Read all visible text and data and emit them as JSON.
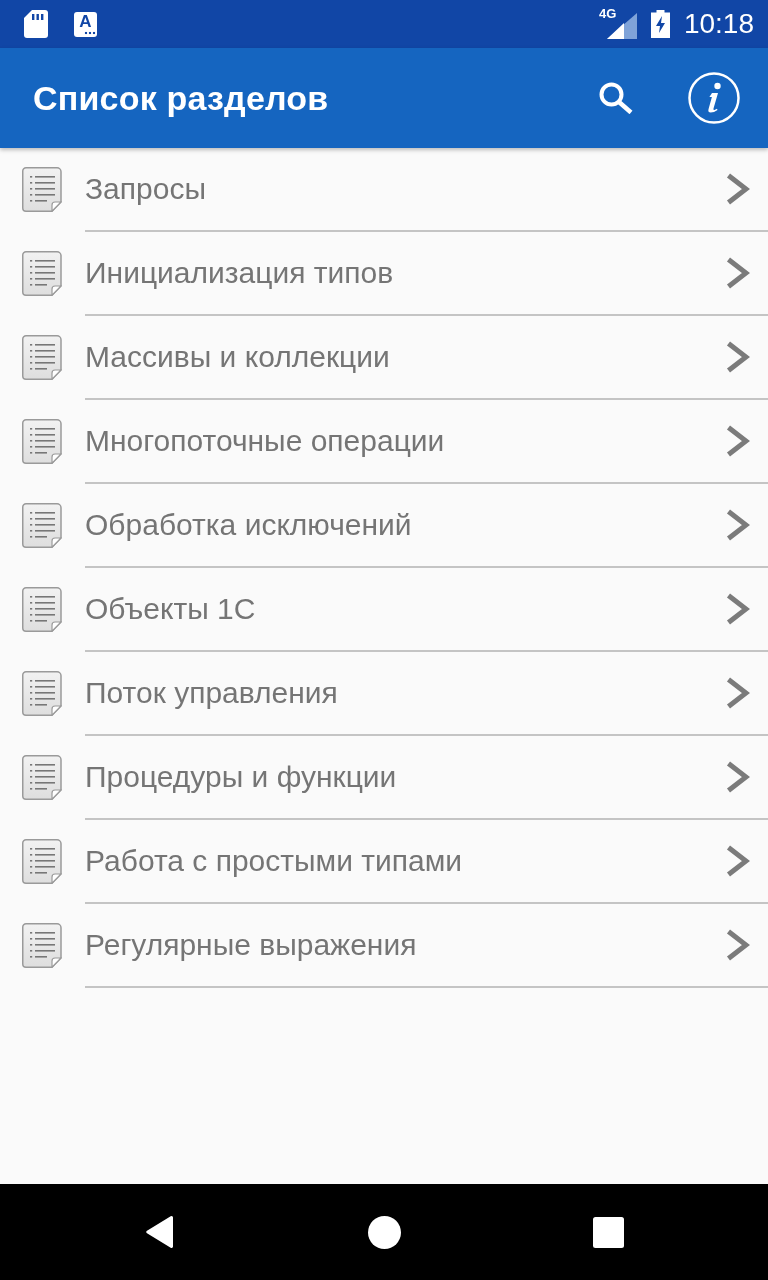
{
  "status_bar": {
    "notifications": [
      {
        "kind": "sd_card"
      },
      {
        "kind": "keyboard",
        "glyph": "A"
      }
    ],
    "network": "4G",
    "time": "10:18"
  },
  "app_bar": {
    "title": "Список разделов",
    "actions": [
      {
        "kind": "search"
      },
      {
        "kind": "info"
      }
    ]
  },
  "sections": [
    {
      "label": "Запросы"
    },
    {
      "label": "Инициализация типов"
    },
    {
      "label": "Массивы и коллекции"
    },
    {
      "label": "Многопоточные операции"
    },
    {
      "label": "Обработка исключений"
    },
    {
      "label": "Объекты 1С"
    },
    {
      "label": "Поток управления"
    },
    {
      "label": "Процедуры и функции"
    },
    {
      "label": "Работа с простыми типами"
    },
    {
      "label": "Регулярные выражения"
    }
  ],
  "nav_bar": {
    "buttons": [
      {
        "kind": "back"
      },
      {
        "kind": "home"
      },
      {
        "kind": "recents"
      }
    ]
  }
}
